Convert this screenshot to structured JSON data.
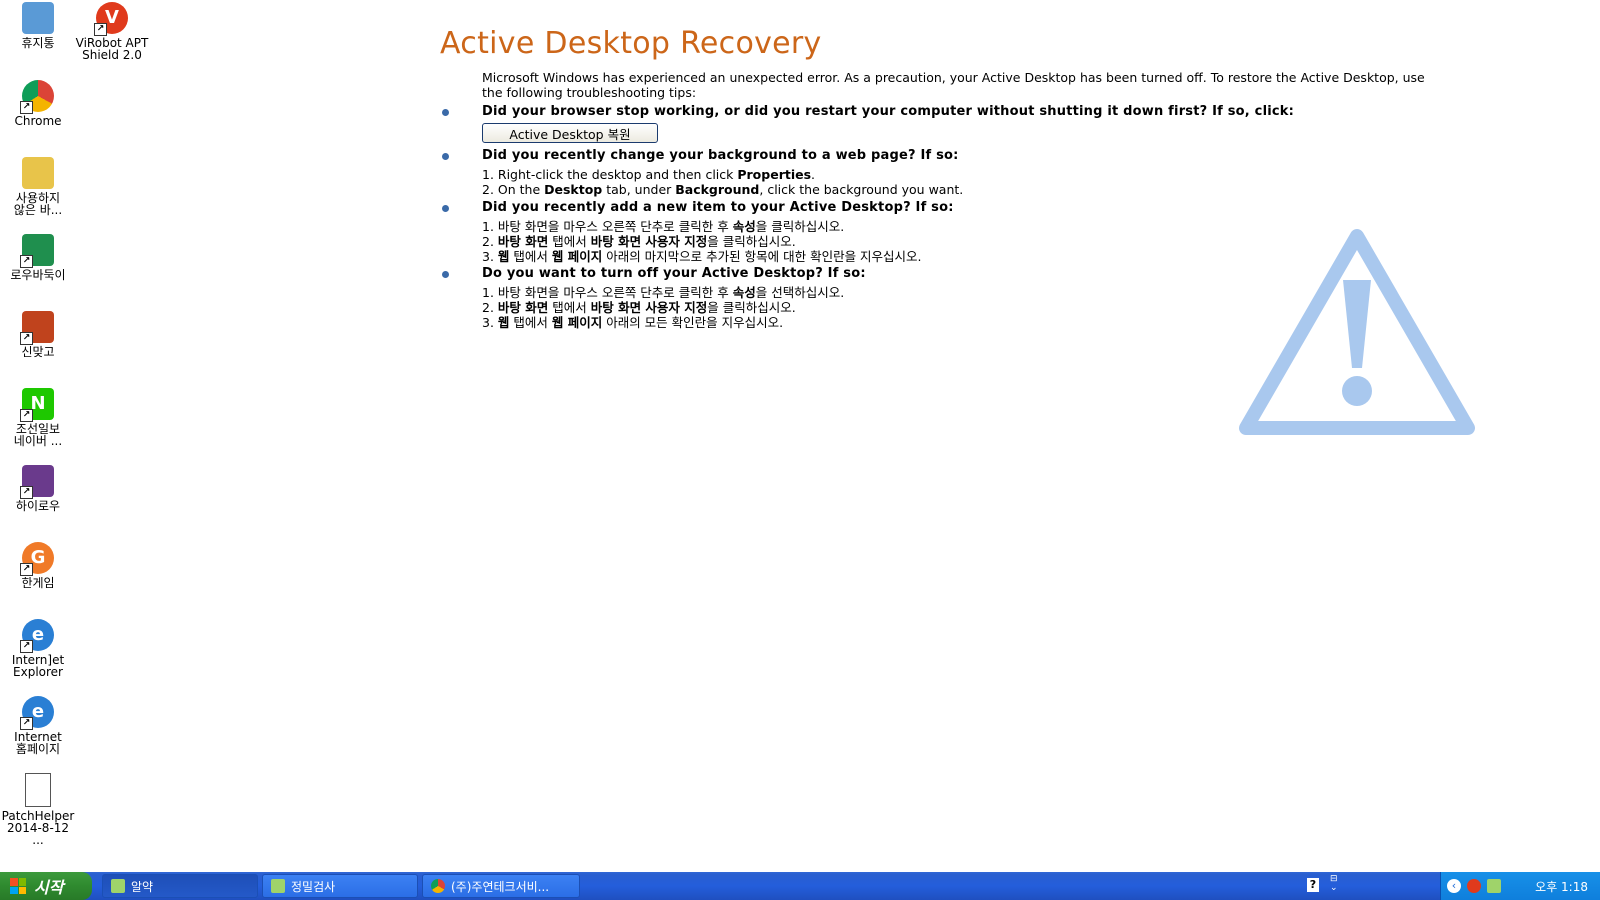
{
  "desktop": {
    "icons": [
      {
        "label_lines": [
          "휴지통"
        ],
        "icon": "recycle-bin-icon",
        "color": "#5a9ad6"
      },
      {
        "label_lines": [
          "ViRobot APT",
          "Shield 2.0"
        ],
        "icon": "virobot-icon",
        "color": "#e03a1c"
      },
      {
        "label_lines": [
          "Chrome"
        ],
        "icon": "chrome-icon",
        "color": "#2e9d45"
      },
      {
        "label_lines": [
          "사용하지",
          "않은 바..."
        ],
        "icon": "folder-icon",
        "color": "#e8c44a"
      },
      {
        "label_lines": [
          "로우바둑이"
        ],
        "icon": "lowbadugi-icon",
        "color": "#1f8f4e"
      },
      {
        "label_lines": [
          "신맞고"
        ],
        "icon": "sinmatgo-icon",
        "color": "#c0431d"
      },
      {
        "label_lines": [
          "조선일보",
          "네이버 ..."
        ],
        "icon": "naver-icon",
        "color": "#1ec800"
      },
      {
        "label_lines": [
          "하이로우"
        ],
        "icon": "hilow-icon",
        "color": "#6a3a8c"
      },
      {
        "label_lines": [
          "한게임"
        ],
        "icon": "hangame-icon",
        "color": "#f07a28"
      },
      {
        "label_lines": [
          "Intern]et",
          "Explorer"
        ],
        "icon": "internet-explorer-icon",
        "color": "#2a7fd4"
      },
      {
        "label_lines": [
          "Internet",
          "홈페이지"
        ],
        "icon": "internet-homepage-icon",
        "color": "#2a7fd4"
      },
      {
        "label_lines": [
          "PatchHelper",
          "2014-8-12 ..."
        ],
        "icon": "patchhelper-file-icon",
        "color": "#ffffff"
      }
    ]
  },
  "content": {
    "title": "Active Desktop Recovery",
    "intro": "Microsoft Windows has experienced an unexpected error. As a precaution, your Active Desktop has been turned off. To restore the Active Desktop, use the following troubleshooting tips:",
    "q1": "Did your browser stop working, or did you restart your computer without shutting it down first? If so, click:",
    "restore_button": "Active Desktop 복원",
    "q2": "Did you recently change your background to a web page? If so:",
    "q2_steps": [
      {
        "pre": "1. Right-click the desktop and then click ",
        "b1": "Properties",
        "mid": ".",
        "b2": "",
        "post": ""
      },
      {
        "pre": "2. On the ",
        "b1": "Desktop",
        "mid": " tab, under ",
        "b2": "Background",
        "post": ", click the background you want."
      }
    ],
    "q3": "Did you recently add a new item to your Active Desktop? If so:",
    "q3_steps": [
      {
        "pre": "1. 바탕 화면을 마우스 오른쪽 단추로 클릭한 후 ",
        "b1": "속성",
        "mid": "을 클릭하십시오.",
        "b2": "",
        "post": ""
      },
      {
        "pre": "2. ",
        "b1": "바탕 화면",
        "mid": " 탭에서 ",
        "b2": "바탕 화면 사용자 지정",
        "post": "을 클릭하십시오."
      },
      {
        "pre": "3. ",
        "b1": "웹",
        "mid": " 탭에서 ",
        "b2": "웹 페이지",
        "post": " 아래의 마지막으로 추가된 항목에 대한 확인란을 지우십시오."
      }
    ],
    "q4": "Do you want to turn off your Active Desktop? If so:",
    "q4_steps": [
      {
        "pre": "1. 바탕 화면을 마우스 오른쪽 단추로 클릭한 후 ",
        "b1": "속성",
        "mid": "을 선택하십시오.",
        "b2": "",
        "post": ""
      },
      {
        "pre": "2. ",
        "b1": "바탕 화면",
        "mid": " 탭에서 ",
        "b2": "바탕 화면 사용자 지정",
        "post": "을 클릭하십시오."
      },
      {
        "pre": "3. ",
        "b1": "웹",
        "mid": " 탭에서 ",
        "b2": "웹 페이지",
        "post": " 아래의 모든 확인란을 지우십시오."
      }
    ],
    "title_color": "#cc6619",
    "warning_color": "#a9c8ee"
  },
  "taskbar": {
    "start_label": "시작",
    "tasks": [
      {
        "label": "알약",
        "icon": "alyac-icon"
      },
      {
        "label": "정밀검사",
        "icon": "alyac-scan-icon"
      },
      {
        "label": "(주)주연테크서비...",
        "icon": "chrome-icon"
      }
    ],
    "clock": "오후 1:18"
  }
}
